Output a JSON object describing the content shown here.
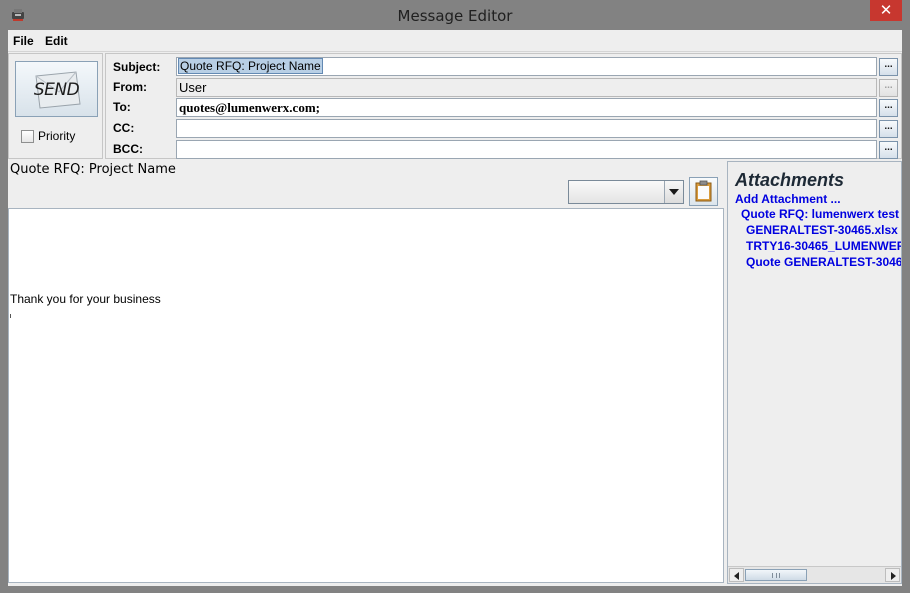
{
  "window": {
    "title": "Message Editor",
    "close_glyph": "✕"
  },
  "menu": {
    "file": "File",
    "edit": "Edit"
  },
  "send": {
    "label": "SEND",
    "icon": "envelope-icon",
    "priority_label": "Priority",
    "priority_checked": false
  },
  "fields": {
    "subject": {
      "label": "Subject:",
      "value": "Quote RFQ: Project Name"
    },
    "from": {
      "label": "From:",
      "value": "User"
    },
    "to": {
      "label": "To:",
      "value": "quotes@lumenwerx.com;"
    },
    "cc": {
      "label": "CC:",
      "value": ""
    },
    "bcc": {
      "label": "BCC:",
      "value": ""
    },
    "browse_label": "..."
  },
  "editor": {
    "title": "Quote RFQ: Project Name",
    "format_value": "",
    "body_text": "Thank you for your business"
  },
  "attachments": {
    "title": "Attachments",
    "add_label": "Add Attachment ...",
    "items": [
      "Quote RFQ: lumenwerx test",
      "GENERALTEST-30465.xlsx",
      "TRTY16-30465_LUMENWER",
      "Quote GENERALTEST-3046"
    ]
  },
  "colors": {
    "chrome": "#828282",
    "close": "#c7372f",
    "link": "#0000e0",
    "selection": "#b8cfe5"
  }
}
